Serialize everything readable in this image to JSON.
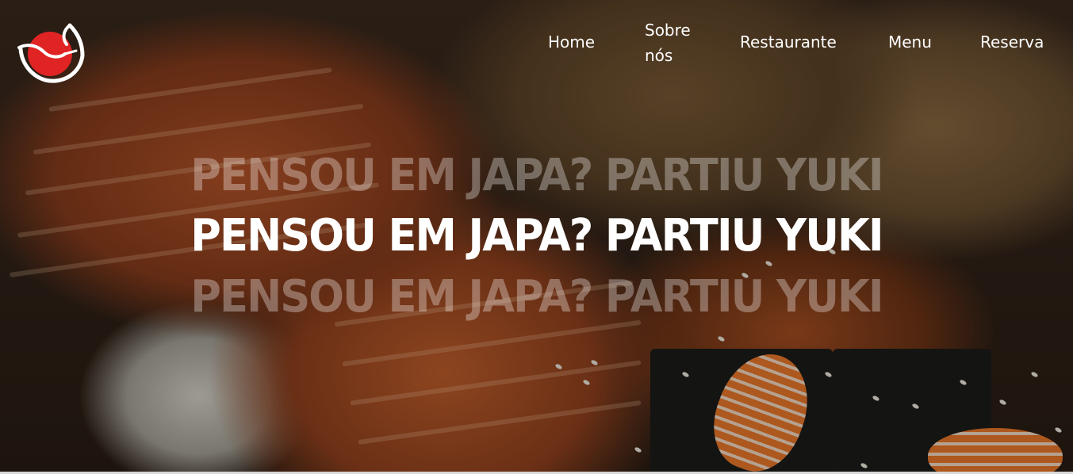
{
  "brand": {
    "logo_icon": "koi-fish-logo-icon",
    "primary_color": "#e02424",
    "swoosh_color": "#ffffff"
  },
  "nav": {
    "items": [
      {
        "label": "Home"
      },
      {
        "label": "Sobre nós"
      },
      {
        "label": "Restaurante"
      },
      {
        "label": "Menu"
      },
      {
        "label": "Reserva"
      }
    ]
  },
  "hero": {
    "headline_ghost_top": "PENSOU EM JAPA? PARTIU YUKI",
    "headline": "PENSOU EM JAPA? PARTIU YUKI",
    "headline_ghost_bottom": "PENSOU EM JAPA? PARTIU YUKI",
    "background_image": "sushi-salmon-photo"
  }
}
